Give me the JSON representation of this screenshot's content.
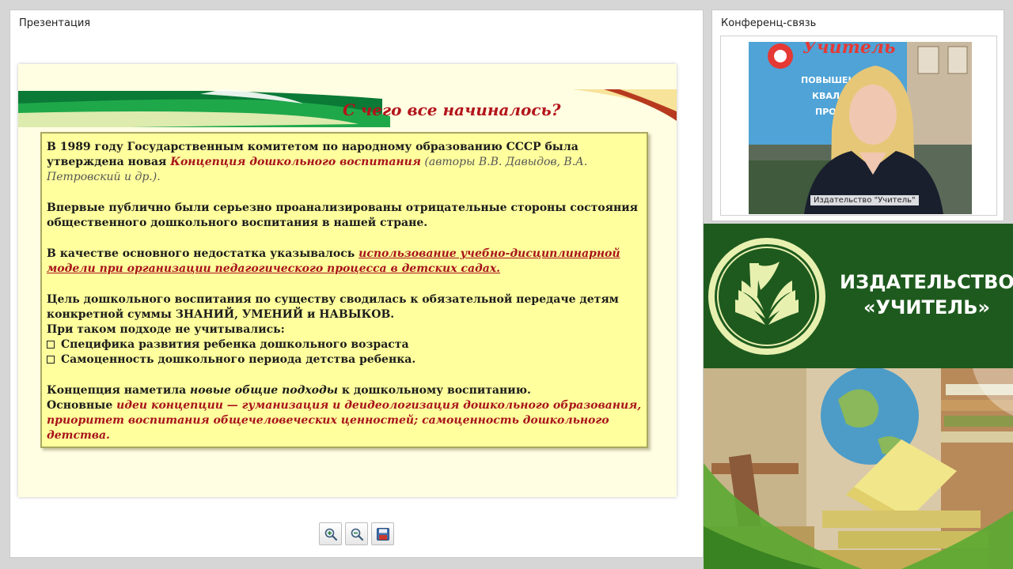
{
  "presentation": {
    "title": "Презентация",
    "slide": {
      "heading": "С чего все начиналось?",
      "p1_a": "В 1989 году Государственным комитетом по народному образованию СССР была утверждена новая ",
      "p1_b": "Концепция дошкольного воспитания",
      "p1_c": " (авторы В.В. Давыдов, В.А. Петровский и др.).",
      "p2": "Впервые публично были серьезно проанализированы отрицательные стороны состояния общественного дошкольного воспитания в нашей стране.",
      "p3_a": "В качестве основного недостатка указывалось ",
      "p3_b": "использование учебно-дисциплинарной модели при организации педагогического процесса в детских садах.",
      "p4_a": "Цель  дошкольного воспитания по существу сводилась  к обязательной передаче детям конкретной суммы ЗНАНИЙ, УМЕНИЙ и НАВЫКОВ.",
      "p4_b": "При таком подходе не учитывались:",
      "bullets": [
        "Специфика  развития ребенка дошкольного возраста",
        "Самоценность дошкольного периода детства ребенка."
      ],
      "p5_a": "Концепция наметила ",
      "p5_b": "новые общие подходы",
      "p5_c": " к дошкольному воспитанию.",
      "p6_a": "Основные ",
      "p6_b": "идеи концепции — гуманизация и деидеологизация дошкольного образования, приоритет воспитания общечеловеческих ценностей; самоценность дошкольного детства."
    },
    "toolbar": {
      "zoom_in_icon": "zoom-in-icon",
      "zoom_out_icon": "zoom-out-icon",
      "save_icon": "save-icon"
    }
  },
  "conference": {
    "title": "Конференц-связь",
    "video_label": "Издательство \"Учитель\"",
    "video_banner_text": "Учитель",
    "video_banner_lines": [
      "ПОВЫШЕНИ",
      "КВАЛ",
      "ПРОФ"
    ]
  },
  "banner": {
    "line1": "ИЗДАТЕЛЬСТВО",
    "line2": "«УЧИТЕЛЬ»",
    "colors": {
      "green": "#1e5a1e",
      "logo": "#e8f0b0"
    }
  }
}
